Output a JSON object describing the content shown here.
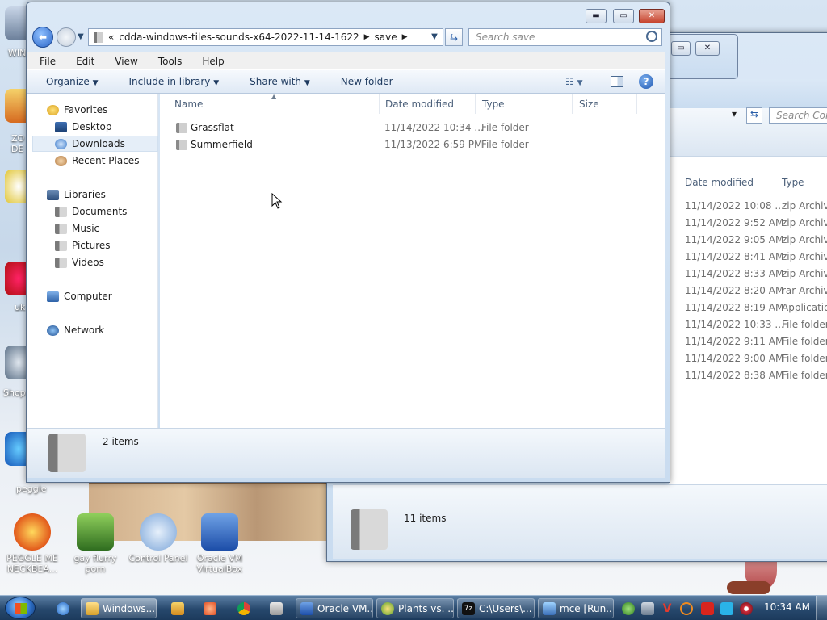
{
  "desktop": {
    "icons": [
      {
        "label": "PEGGLE ME NECKBEA...",
        "color": "#e24c1f"
      },
      {
        "label": "gay flurry porn",
        "color": "#3f7b2a"
      },
      {
        "label": "Control Panel",
        "color": "#5c8ad1"
      },
      {
        "label": "Oracle VM VirtualBox",
        "color": "#2e64c4"
      }
    ],
    "edge_labels": [
      "WIN",
      "ZO DE",
      "uk",
      "Shop",
      "peggle"
    ]
  },
  "back_window": {
    "search_placeholder": "Search Com",
    "columns": {
      "date": "Date modified",
      "type": "Type"
    },
    "rows": [
      {
        "date": "11/14/2022 10:08 ...",
        "type": "zip Archive"
      },
      {
        "date": "11/14/2022 9:52 AM",
        "type": "zip Archive"
      },
      {
        "date": "11/14/2022 9:05 AM",
        "type": "zip Archive"
      },
      {
        "date": "11/14/2022 8:41 AM",
        "type": "zip Archive"
      },
      {
        "date": "11/14/2022 8:33 AM",
        "type": "zip Archive"
      },
      {
        "date": "11/14/2022 8:20 AM",
        "type": "rar Archive"
      },
      {
        "date": "11/14/2022 8:19 AM",
        "type": "Application"
      },
      {
        "date": "11/14/2022 10:33 ...",
        "type": "File folder"
      },
      {
        "date": "11/14/2022 9:11 AM",
        "type": "File folder"
      },
      {
        "date": "11/14/2022 9:00 AM",
        "type": "File folder"
      },
      {
        "date": "11/14/2022 8:38 AM",
        "type": "File folder"
      }
    ],
    "status": "11 items"
  },
  "explorer": {
    "address": {
      "chevron": "«",
      "segments": [
        "cdda-windows-tiles-sounds-x64-2022-11-14-1622",
        "save"
      ]
    },
    "search_placeholder": "Search save",
    "menu": [
      "File",
      "Edit",
      "View",
      "Tools",
      "Help"
    ],
    "toolbar": {
      "organize": "Organize",
      "include_in_library": "Include in library",
      "share_with": "Share with",
      "new_folder": "New folder"
    },
    "nav": {
      "favorites": "Favorites",
      "favorites_items": [
        "Desktop",
        "Downloads",
        "Recent Places"
      ],
      "libraries": "Libraries",
      "library_items": [
        "Documents",
        "Music",
        "Pictures",
        "Videos"
      ],
      "computer": "Computer",
      "network": "Network"
    },
    "columns": {
      "name": "Name",
      "date": "Date modified",
      "type": "Type",
      "size": "Size"
    },
    "files": [
      {
        "name": "Grassflat",
        "date": "11/14/2022 10:34 ...",
        "type": "File folder"
      },
      {
        "name": "Summerfield",
        "date": "11/13/2022 6:59 PM",
        "type": "File folder"
      }
    ],
    "status": "2 items"
  },
  "taskbar": {
    "buttons": [
      "Windows...",
      "Oracle VM...",
      "Plants vs. ...",
      "C:\\Users\\...",
      "mce [Run..."
    ],
    "clock": "10:34 AM"
  }
}
